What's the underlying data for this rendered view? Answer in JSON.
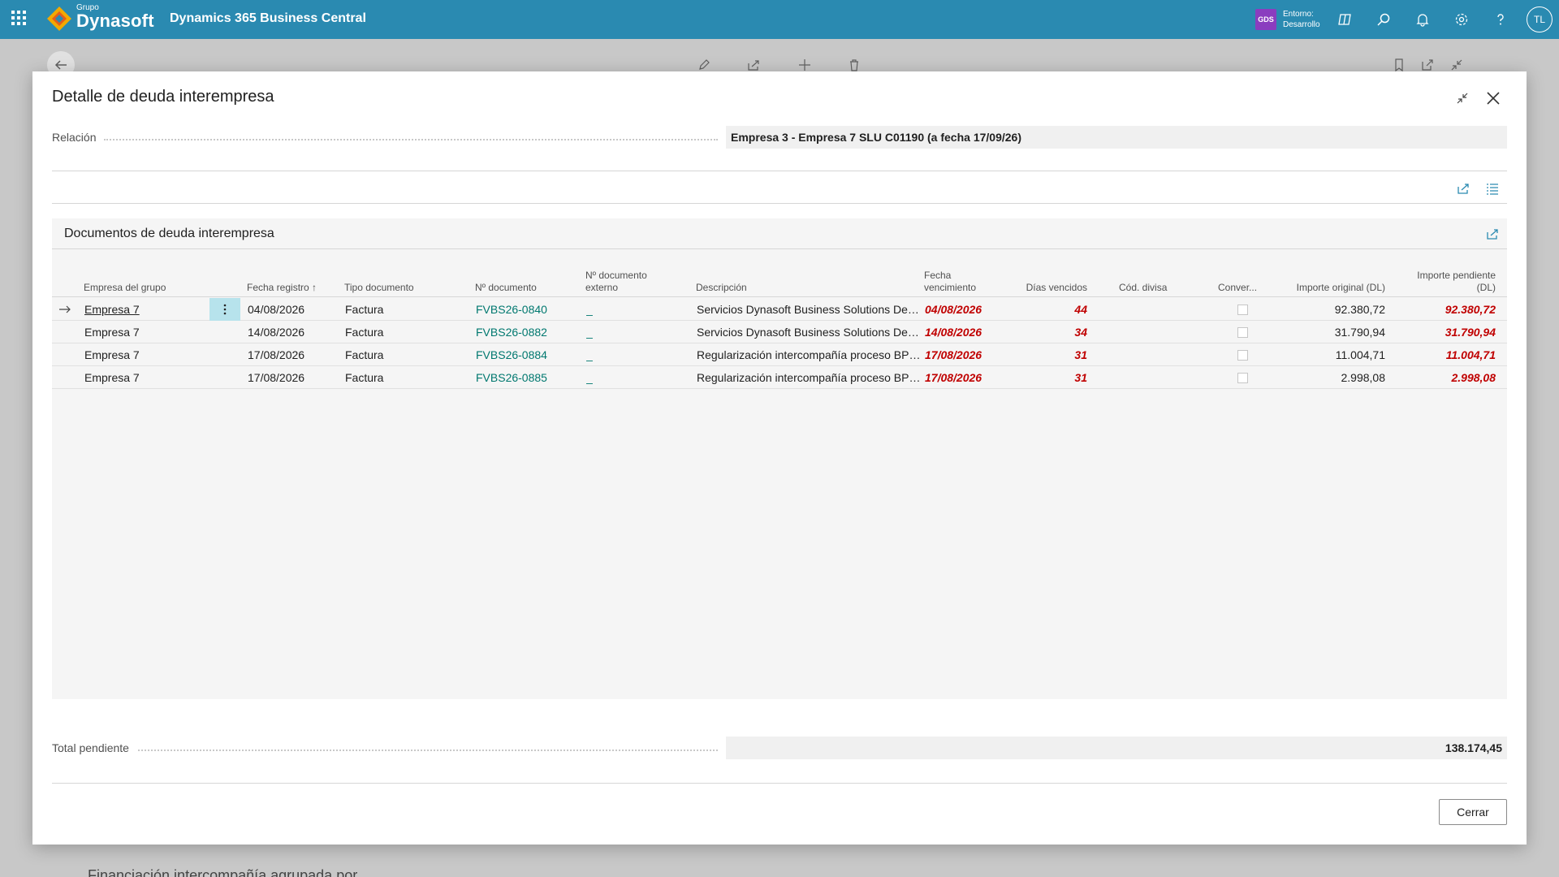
{
  "topbar": {
    "logo_small": "Grupo",
    "logo_big": "Dynasoft",
    "app_title": "Dynamics 365 Business Central",
    "env_badge": "GDS",
    "env_line1": "Entorno:",
    "env_line2": "Desarrollo",
    "avatar": "TL",
    "icons": [
      "copilot-icon",
      "search-icon",
      "bell-icon",
      "gear-icon",
      "help-icon"
    ],
    "color": "#2a8ab1"
  },
  "background_page": {
    "partial_text": "Financiación intercompañía agrupada por ..."
  },
  "dialog": {
    "title": "Detalle de deuda interempresa",
    "relation_label": "Relación",
    "relation_value": "Empresa 3 - Empresa 7 SLU C01190 (a fecha 17/09/26)",
    "subpage_title": "Documentos de deuda interempresa",
    "columns": {
      "empresa": "Empresa del grupo",
      "fecha_registro": "Fecha registro",
      "sort_indicator": "↑",
      "tipo": "Tipo documento",
      "num_doc": "Nº documento",
      "num_ext_1": "Nº documento",
      "num_ext_2": "externo",
      "descripcion": "Descripción",
      "venc_1": "Fecha",
      "venc_2": "vencimiento",
      "dias": "Días vencidos",
      "divisa": "Cód. divisa",
      "conver": "Conver...",
      "importe_original": "Importe original (DL)",
      "pend_1": "Importe pendiente",
      "pend_2": "(DL)"
    },
    "rows": [
      {
        "empresa": "Empresa 7",
        "fecha": "04/08/2026",
        "tipo": "Factura",
        "num": "FVBS26-0840",
        "ext": "_",
        "desc": "Servicios Dynasoft Business Solutions Des...",
        "venc": "04/08/2026",
        "dias": "44",
        "divisa": "",
        "orig": "92.380,72",
        "pend": "92.380,72"
      },
      {
        "empresa": "Empresa 7",
        "fecha": "14/08/2026",
        "tipo": "Factura",
        "num": "FVBS26-0882",
        "ext": "_",
        "desc": "Servicios Dynasoft Business Solutions Des...",
        "venc": "14/08/2026",
        "dias": "34",
        "divisa": "",
        "orig": "31.790,94",
        "pend": "31.790,94"
      },
      {
        "empresa": "Empresa 7",
        "fecha": "17/08/2026",
        "tipo": "Factura",
        "num": "FVBS26-0884",
        "ext": "_",
        "desc": "Regularización intercompañía proceso BPF...",
        "venc": "17/08/2026",
        "dias": "31",
        "divisa": "",
        "orig": "11.004,71",
        "pend": "11.004,71"
      },
      {
        "empresa": "Empresa 7",
        "fecha": "17/08/2026",
        "tipo": "Factura",
        "num": "FVBS26-0885",
        "ext": "_",
        "desc": "Regularización intercompañía proceso BPF...",
        "venc": "17/08/2026",
        "dias": "31",
        "divisa": "",
        "orig": "2.998,08",
        "pend": "2.998,08"
      }
    ],
    "total_label": "Total pendiente",
    "total_value": "138.174,45",
    "close_button": "Cerrar",
    "colors": {
      "overdue": "#c00000",
      "link": "#00786f",
      "selected_menu": "#b7e3ec"
    }
  }
}
